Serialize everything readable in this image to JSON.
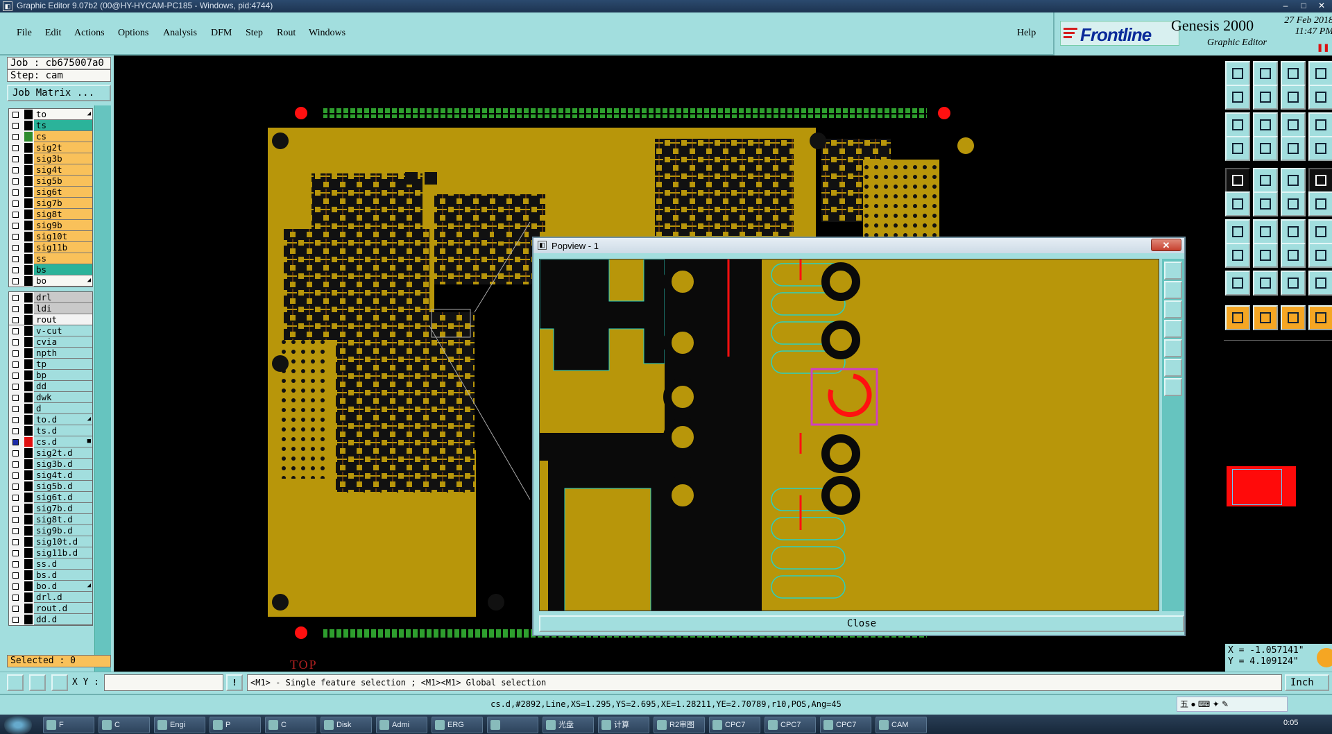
{
  "os_title": "Graphic Editor 9.07b2 (00@HY-HYCAM-PC185 - Windows, pid:4744)",
  "menu": [
    "File",
    "Edit",
    "Actions",
    "Options",
    "Analysis",
    "DFM",
    "Step",
    "Rout",
    "Windows"
  ],
  "help_label": "Help",
  "brand": {
    "logo": "Frontline",
    "product": "Genesis 2000",
    "subtitle": "Graphic Editor",
    "date": "27 Feb 2018",
    "time": "11:47 PM",
    "colors": {
      "panel": "#a2dede",
      "copper": "#b8960a",
      "highlight": "#ff1010"
    }
  },
  "job": "Job : cb675007a0",
  "step": "Step: cam",
  "job_matrix_label": "Job Matrix ...",
  "layer_groups": [
    [
      {
        "name": "to",
        "color": "#f7f7f3",
        "swatch": "black",
        "mark": "arrow"
      },
      {
        "name": "ts",
        "color": "#2bb39a",
        "swatch": "black"
      },
      {
        "name": "cs",
        "color": "#f9c15a",
        "swatch": "green"
      },
      {
        "name": "sig2t",
        "color": "#f9c15a",
        "swatch": "black"
      },
      {
        "name": "sig3b",
        "color": "#f9c15a",
        "swatch": "black"
      },
      {
        "name": "sig4t",
        "color": "#f9c15a",
        "swatch": "black"
      },
      {
        "name": "sig5b",
        "color": "#f9c15a",
        "swatch": "black"
      },
      {
        "name": "sig6t",
        "color": "#f9c15a",
        "swatch": "black"
      },
      {
        "name": "sig7b",
        "color": "#f9c15a",
        "swatch": "black"
      },
      {
        "name": "sig8t",
        "color": "#f9c15a",
        "swatch": "black"
      },
      {
        "name": "sig9b",
        "color": "#f9c15a",
        "swatch": "black"
      },
      {
        "name": "sig10t",
        "color": "#f9c15a",
        "swatch": "black"
      },
      {
        "name": "sig11b",
        "color": "#f9c15a",
        "swatch": "black"
      },
      {
        "name": "ss",
        "color": "#f9c15a",
        "swatch": "black"
      },
      {
        "name": "bs",
        "color": "#2bb39a",
        "swatch": "black"
      },
      {
        "name": "bo",
        "color": "#f7f7f3",
        "swatch": "black",
        "mark": "arrow"
      }
    ],
    [
      {
        "name": "drl",
        "color": "#c9c9c9",
        "swatch": "black"
      },
      {
        "name": "ldi",
        "color": "#c9c9c9",
        "swatch": "black"
      },
      {
        "name": "rout",
        "color": "#f3f3f3",
        "swatch": "black"
      }
    ],
    [
      {
        "name": "v-cut",
        "color": "#a2dede",
        "swatch": "black"
      },
      {
        "name": "cvia",
        "color": "#a2dede",
        "swatch": "black"
      },
      {
        "name": "npth",
        "color": "#a2dede",
        "swatch": "black"
      },
      {
        "name": "tp",
        "color": "#a2dede",
        "swatch": "black"
      },
      {
        "name": "bp",
        "color": "#a2dede",
        "swatch": "black"
      },
      {
        "name": "dd",
        "color": "#a2dede",
        "swatch": "black"
      },
      {
        "name": "dwk",
        "color": "#a2dede",
        "swatch": "black"
      },
      {
        "name": "d",
        "color": "#a2dede",
        "swatch": "black"
      },
      {
        "name": "to.d",
        "color": "#a2dede",
        "swatch": "black",
        "mark": "arrow"
      },
      {
        "name": "ts.d",
        "color": "#a2dede",
        "swatch": "black"
      },
      {
        "name": "cs.d",
        "color": "#a2dede",
        "swatch": "red",
        "checked": true,
        "mark": "square"
      },
      {
        "name": "sig2t.d",
        "color": "#a2dede",
        "swatch": "black"
      },
      {
        "name": "sig3b.d",
        "color": "#a2dede",
        "swatch": "black"
      },
      {
        "name": "sig4t.d",
        "color": "#a2dede",
        "swatch": "black"
      },
      {
        "name": "sig5b.d",
        "color": "#a2dede",
        "swatch": "black"
      },
      {
        "name": "sig6t.d",
        "color": "#a2dede",
        "swatch": "black"
      },
      {
        "name": "sig7b.d",
        "color": "#a2dede",
        "swatch": "black"
      },
      {
        "name": "sig8t.d",
        "color": "#a2dede",
        "swatch": "black"
      },
      {
        "name": "sig9b.d",
        "color": "#a2dede",
        "swatch": "black"
      },
      {
        "name": "sig10t.d",
        "color": "#a2dede",
        "swatch": "black"
      },
      {
        "name": "sig11b.d",
        "color": "#a2dede",
        "swatch": "black"
      },
      {
        "name": "ss.d",
        "color": "#a2dede",
        "swatch": "black"
      },
      {
        "name": "bs.d",
        "color": "#a2dede",
        "swatch": "black"
      },
      {
        "name": "bo.d",
        "color": "#a2dede",
        "swatch": "black",
        "mark": "arrow"
      },
      {
        "name": "drl.d",
        "color": "#a2dede",
        "swatch": "black"
      },
      {
        "name": "rout.d",
        "color": "#a2dede",
        "swatch": "black"
      },
      {
        "name": "dd.d",
        "color": "#a2dede",
        "swatch": "black"
      }
    ]
  ],
  "selected": "Selected : 0",
  "canvas_label": "TOP",
  "popview": {
    "title": "Popview - 1",
    "close_label": "Close",
    "close_x": "✕"
  },
  "coords": {
    "x": "X = -1.057141\"",
    "y": "Y = 4.109124\""
  },
  "cmd": {
    "xy_label": "X Y :",
    "xy_value": "",
    "alert": "!",
    "hint": "<M1> - Single feature selection ; <M1><M1> Global selection",
    "units": "Inch"
  },
  "status": "cs.d,#2892,Line,XS=1.295,YS=2.695,XE=1.28211,YE=2.70789,r10,POS,Ang=45",
  "ime": "五",
  "clock": "0:05",
  "taskbar": [
    "F",
    "C",
    "Engi",
    "P",
    "C",
    "Disk",
    "Admi",
    "ERG",
    "",
    "光盘",
    "计算",
    "R2审图",
    "CPC7",
    "CPC7",
    "CPC7",
    "CAM"
  ]
}
